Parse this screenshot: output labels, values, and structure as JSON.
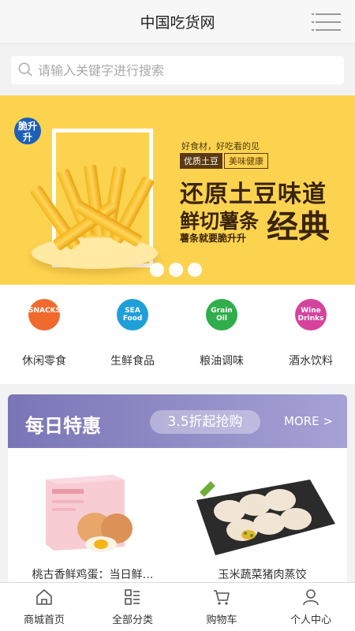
{
  "header": {
    "title": "中国吃货网",
    "menu_icon": "hamburger-menu-icon"
  },
  "search": {
    "placeholder": "请输入关键字进行搜索",
    "icon": "search-icon"
  },
  "banner": {
    "logo_text": "脆升升",
    "tagline": "好食材，好吃看的见",
    "tag_primary": "优质土豆",
    "tag_secondary": "美味健康",
    "headline1": "还原土豆味道",
    "headline2": "鲜切薯条",
    "headline3": "经典",
    "slogan": "薯条就要脆升升",
    "slide_count": 3
  },
  "categories": [
    {
      "label": "休闲零食",
      "icon_text": "SNACKS",
      "color": "#f06a2d",
      "icon": "snacks-icon"
    },
    {
      "label": "生鲜食品",
      "icon_text": "SEA Food",
      "color": "#1f9fd9",
      "icon": "seafood-icon"
    },
    {
      "label": "粮油调味",
      "icon_text": "Grain Oil",
      "color": "#2fae4b",
      "icon": "grain-oil-icon"
    },
    {
      "label": "酒水饮料",
      "icon_text": "Wine Drinks",
      "color": "#d5439c",
      "icon": "wine-drinks-icon"
    }
  ],
  "deals": {
    "title": "每日特惠",
    "promo": "3.5折起抢购",
    "more": "MORE >",
    "products": [
      {
        "name": "桃古香鲜鸡蛋：当日鲜…"
      },
      {
        "name": "玉米蔬菜猪肉蒸饺"
      }
    ]
  },
  "tabbar": [
    {
      "label": "商城首页",
      "icon": "home-icon"
    },
    {
      "label": "全部分类",
      "icon": "category-icon"
    },
    {
      "label": "购物车",
      "icon": "cart-icon"
    },
    {
      "label": "个人中心",
      "icon": "user-icon"
    }
  ]
}
